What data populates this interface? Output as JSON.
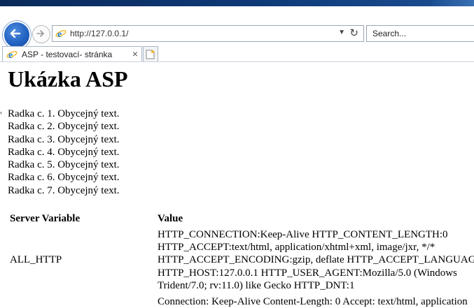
{
  "browser": {
    "address": "http://127.0.0.1/",
    "search_placeholder": "Search...",
    "tab_title": "ASP - testovací- stránka",
    "icons": [
      "back-arrow-icon",
      "forward-arrow-icon",
      "ie-icon",
      "dropdown-icon",
      "refresh-icon",
      "close-icon",
      "new-tab-icon"
    ]
  },
  "page": {
    "heading": "Ukázka ASP",
    "side_mark": "‹",
    "lines": [
      "Radka c. 1. Obycejný text.",
      "Radka c. 2. Obycejný text.",
      "Radka c. 3. Obycejný text.",
      "Radka c. 4. Obycejný text.",
      "Radka c. 5. Obycejný text.",
      "Radka c. 6. Obycejný text.",
      "Radka c. 7. Obycejný text."
    ],
    "table": {
      "headers": [
        "Server Variable",
        "Value"
      ],
      "rows": [
        {
          "name": "ALL_HTTP",
          "value_lines": [
            "HTTP_CONNECTION:Keep-Alive HTTP_CONTENT_LENGTH:0",
            "HTTP_ACCEPT:text/html, application/xhtml+xml, image/jxr, */*",
            "HTTP_ACCEPT_ENCODING:gzip, deflate HTTP_ACCEPT_LANGUAGE",
            "HTTP_HOST:127.0.0.1 HTTP_USER_AGENT:Mozilla/5.0 (Windows",
            "Trident/7.0; rv:11.0) like Gecko HTTP_DNT:1"
          ]
        }
      ],
      "next_value": "Connection: Keep-Alive Content-Length: 0 Accept: text/html, application"
    }
  },
  "colors": {
    "chrome_accent": "#1f5fbf",
    "title_strip": "#0f3a78"
  }
}
